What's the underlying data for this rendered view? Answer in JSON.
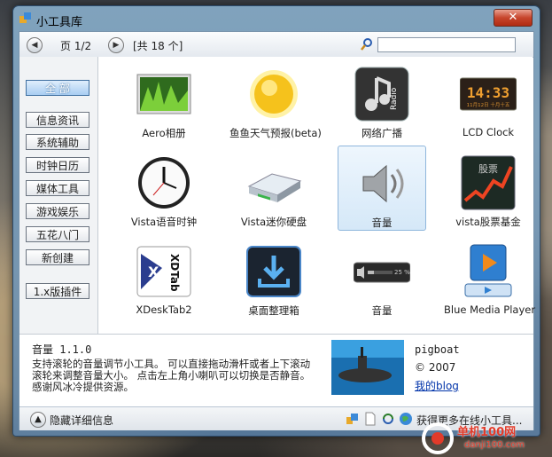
{
  "window": {
    "title": "小工具库",
    "close_label": "✕"
  },
  "toolbar": {
    "prev_icon": "chevron-left-icon",
    "next_icon": "chevron-right-icon",
    "page_label": "页 1/2",
    "total_label": "[共 18 个]",
    "search_placeholder": ""
  },
  "sidebar": {
    "items": [
      {
        "label": "全 部",
        "active": true
      },
      {
        "label": "信息资讯"
      },
      {
        "label": "系统辅助"
      },
      {
        "label": "时钟日历"
      },
      {
        "label": "媒体工具"
      },
      {
        "label": "游戏娱乐"
      },
      {
        "label": "五花八门"
      },
      {
        "label": "新创建"
      },
      {
        "label": "1.x版插件"
      }
    ]
  },
  "gadgets": [
    {
      "label": "Aero相册",
      "icon": "photo-album-icon"
    },
    {
      "label": "鱼鱼天气预报(beta)",
      "icon": "sun-icon"
    },
    {
      "label": "网络广播",
      "icon": "radio-icon"
    },
    {
      "label": "LCD Clock",
      "icon": "lcd-clock-icon",
      "clock_time": "14:33",
      "clock_date": "11月12日 十月十五"
    },
    {
      "label": "Vista语音时钟",
      "icon": "analog-clock-icon"
    },
    {
      "label": "Vista迷你硬盘",
      "icon": "hard-drive-icon"
    },
    {
      "label": "音量",
      "icon": "speaker-icon",
      "selected": true
    },
    {
      "label": "vista股票基金",
      "icon": "stock-chart-icon",
      "icon_text": "股票"
    },
    {
      "label": "XDeskTab2",
      "icon": "xdesktab-icon",
      "icon_text": "XDTab"
    },
    {
      "label": "桌面整理箱",
      "icon": "desktop-organizer-icon"
    },
    {
      "label": "音量",
      "icon": "volume-slider-icon",
      "icon_text": "25 %"
    },
    {
      "label": "Blue Media Player",
      "icon": "media-player-icon"
    }
  ],
  "details": {
    "title": "音量 1.1.0",
    "description": "支持滚轮的音量调节小工具。 可以直接拖动滑杆或者上下滚动滚轮来调整音量大小。 点击左上角小喇叭可以切换是否静音。 感谢风冰冷提供资源。",
    "author": "pigboat",
    "copyright": "© 2007",
    "blog_link": "我的blog",
    "thumbnail_icon": "submarine-icon"
  },
  "statusbar": {
    "hide_label": "隐藏详细信息",
    "more_label": "获得更多在线小工具..."
  },
  "watermark": {
    "text": "单机100网",
    "sub": "danji100.com"
  },
  "colors": {
    "accent": "#3f6fa0",
    "close": "#c7452c",
    "selection": "#d5e8f8"
  }
}
